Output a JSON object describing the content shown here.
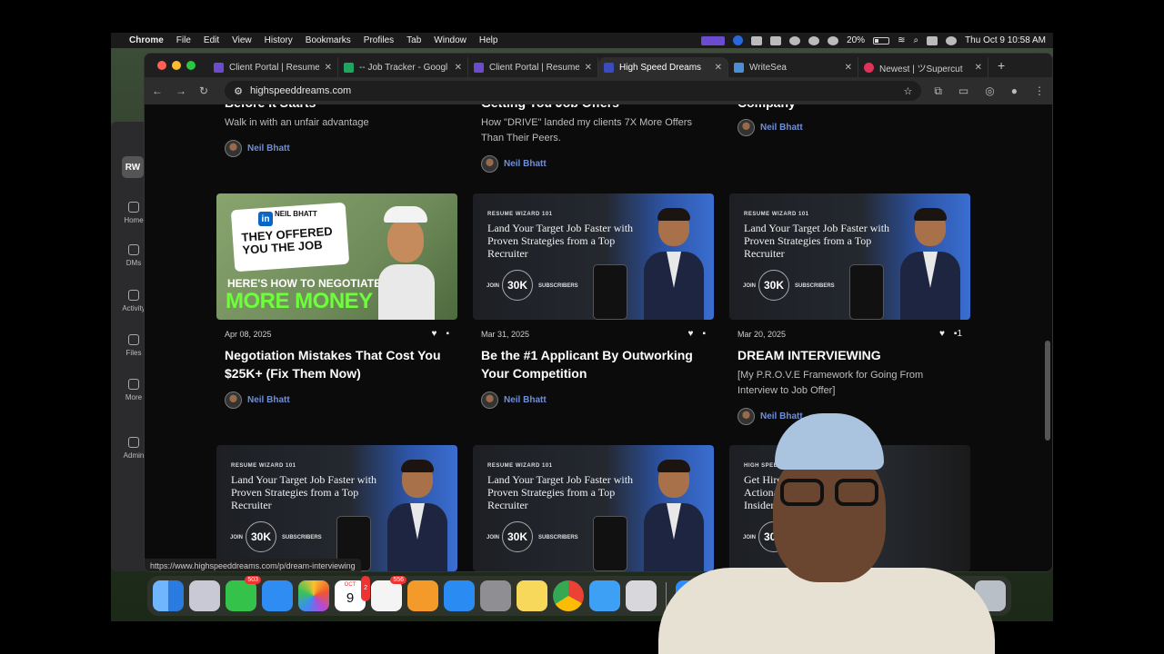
{
  "menubar": {
    "app": "Chrome",
    "menus": [
      "File",
      "Edit",
      "View",
      "History",
      "Bookmarks",
      "Profiles",
      "Tab",
      "Window",
      "Help"
    ],
    "battery": "20%",
    "clock": "Thu Oct 9  10:58 AM"
  },
  "slack": {
    "logo": "RW",
    "items": [
      "Home",
      "DMs",
      "Activity",
      "Files",
      "More",
      "Admin"
    ]
  },
  "tabs": [
    {
      "label": "Client Portal | Resume",
      "color": "#6b4ccf"
    },
    {
      "label": "-- Job Tracker - Googl",
      "color": "#1fa463"
    },
    {
      "label": "Client Portal | Resume",
      "color": "#6b4ccf"
    },
    {
      "label": "High Speed Dreams",
      "color": "#3a4cc0"
    },
    {
      "label": "WriteSea",
      "color": "#4a8fd6"
    },
    {
      "label": "Newest | ツSupercut",
      "color": "#e0335a"
    }
  ],
  "address": "highspeeddreams.com",
  "status_url": "https://www.highspeeddreams.com/p/dream-interviewing",
  "top_row": [
    {
      "title_partial": "Before It Starts",
      "sub": "Walk in with an unfair advantage",
      "author": "Neil Bhatt"
    },
    {
      "title_partial": "Getting You Job Offers",
      "sub": "How \"DRIVE\" landed my clients 7X More Offers Than Their Peers.",
      "author": "Neil Bhatt"
    },
    {
      "title_partial": "Company",
      "sub": "",
      "author": "Neil Bhatt"
    }
  ],
  "posts": [
    {
      "date": "Apr 08, 2025",
      "title": "Negotiation Mistakes That Cost You $25K+ (Fix Them Now)",
      "sub": "",
      "author": "Neil Bhatt",
      "comments": "",
      "thumb": {
        "brand": "NEIL BHATT",
        "line1": "THEY OFFERED YOU THE JOB",
        "line2": "HERE'S HOW TO NEGOTIATE",
        "line3": "MORE MONEY"
      }
    },
    {
      "date": "Mar 31, 2025",
      "title": "Be the #1 Applicant By Outworking Your Competition",
      "sub": "",
      "author": "Neil Bhatt",
      "comments": "",
      "thumb": {
        "kicker": "RESUME WIZARD 101",
        "headline": "Land Your Target Job Faster with Proven Strategies from a Top Recruiter",
        "join": "JOIN",
        "count": "30K",
        "subs": "SUBSCRIBERS"
      }
    },
    {
      "date": "Mar 20, 2025",
      "title": "DREAM INTERVIEWING",
      "sub": "[My P.R.O.V.E Framework for Going From Interview to Job Offer]",
      "author": "Neil Bhatt",
      "comments": "1",
      "thumb": {
        "kicker": "RESUME WIZARD 101",
        "headline": "Land Your Target Job Faster with Proven Strategies from a Top Recruiter",
        "join": "JOIN",
        "count": "30K",
        "subs": "SUBSCRIBERS"
      }
    }
  ],
  "bottom_row": [
    {
      "kicker": "RESUME WIZARD 101",
      "headline": "Land Your Target Job Faster with Proven Strategies from a Top Recruiter",
      "join": "JOIN",
      "count": "30K",
      "subs": "SUBSCRIBERS"
    },
    {
      "kicker": "RESUME WIZARD 101",
      "headline": "Land Your Target Job Faster with Proven Strategies from a Top Recruiter",
      "join": "JOIN",
      "count": "30K",
      "subs": "SUBSCRIBERS"
    },
    {
      "kicker": "HIGH SPEED DREA",
      "headline": "Get Hired F Actionable S Insider Recr",
      "join": "JOIN",
      "count": "30K",
      "subs": ""
    }
  ],
  "dock": {
    "messages_badge": "503",
    "calendar_month": "OCT",
    "calendar_day": "9",
    "calendar_badge": "2",
    "reminders_badge": "556",
    "zoom_label": "zoom"
  }
}
